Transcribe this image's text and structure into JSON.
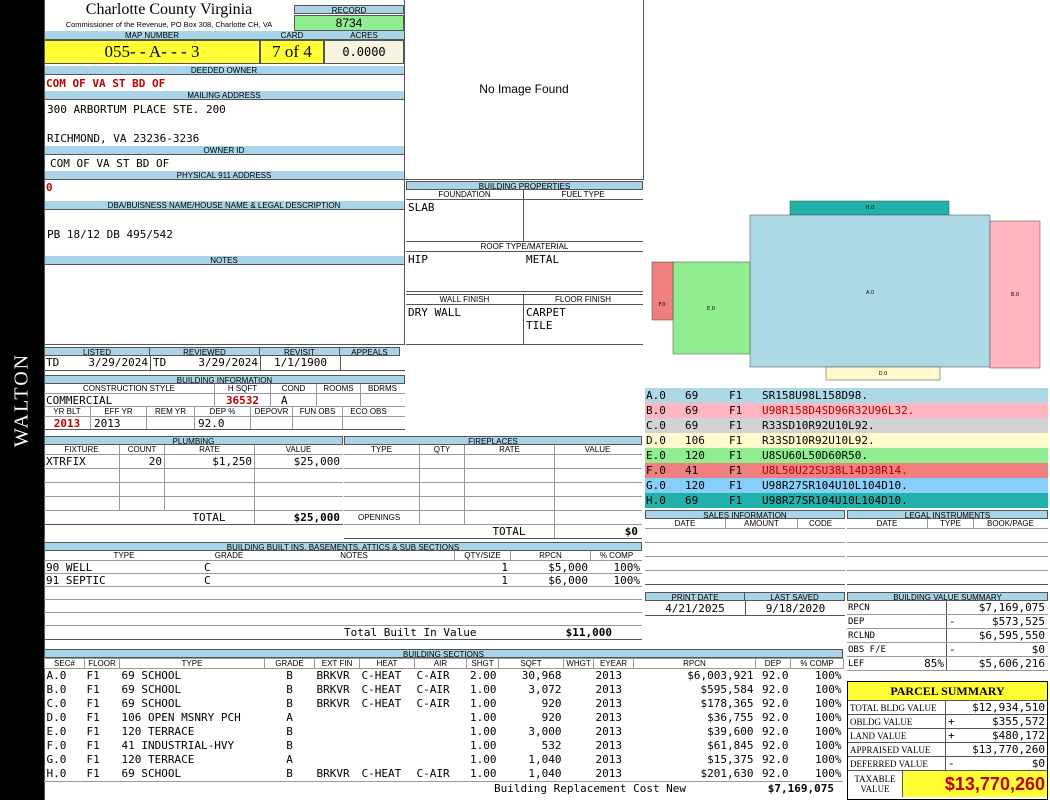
{
  "sidebar": {
    "name": "WALTON"
  },
  "header": {
    "county": "Charlotte County Virginia",
    "commissioner": "Commissioner of the Revenue, PO Box 308, Charlotte CH, VA",
    "record_label": "RECORD",
    "record_value": "8734",
    "map_number_label": "MAP NUMBER",
    "map_number": "055- - A- - - 3",
    "card_label": "CARD",
    "card": "7 of 4",
    "acres_label": "ACRES",
    "acres": "0.0000"
  },
  "owner": {
    "deeded_owner_label": "DEEDED OWNER",
    "deeded_owner": "COM OF VA ST BD OF",
    "mailing_address_label": "MAILING ADDRESS",
    "mailing_line1": "300 ARBORTUM PLACE STE. 200",
    "mailing_line2": "RICHMOND, VA 23236-3236",
    "owner_id_label": "OWNER ID",
    "owner_id": "COM OF VA ST BD OF",
    "physical_label": "PHYSICAL 911 ADDRESS",
    "physical": "0",
    "dba_label": "DBA/BUISNESS NAME/HOUSE NAME & LEGAL DESCRIPTION",
    "legal": "PB 18/12 DB 495/542",
    "notes_label": "NOTES"
  },
  "photo": {
    "text": "No Image Found"
  },
  "building_properties": {
    "title": "BUILDING PROPERTIES",
    "foundation_label": "FOUNDATION",
    "fuel_label": "FUEL TYPE",
    "foundation": "SLAB",
    "fuel": "",
    "roof_label": "ROOF TYPE/MATERIAL",
    "roof_type": "HIP",
    "roof_material": "METAL",
    "wall_label": "WALL FINISH",
    "floor_label": "FLOOR FINISH",
    "wall": "DRY WALL",
    "floor1": "CARPET",
    "floor2": "TILE"
  },
  "dates": {
    "listed_label": "LISTED",
    "reviewed_label": "REVIEWED",
    "revisit_label": "REVISIT",
    "appeals_label": "APPEALS",
    "listed_code": "TD",
    "listed": "3/29/2024",
    "reviewed_code": "TD",
    "reviewed": "3/29/2024",
    "revisit": "1/1/1900",
    "appeals": ""
  },
  "building_info": {
    "title": "BUILDING INFORMATION",
    "style_label": "CONSTRUCTION STYLE",
    "hsqft_label": "H SQFT",
    "cond_label": "COND",
    "rooms_label": "ROOMS",
    "bdrms_label": "BDRMS",
    "style": "COMMERCIAL",
    "hsqft": "36532",
    "cond": "A",
    "yrblt_label": "YR BLT",
    "effyr_label": "EFF YR",
    "remyr_label": "REM YR",
    "dep_label": "DEP %",
    "depovr_label": "DEPOVR",
    "funobs_label": "FUN OBS",
    "ecoobs_label": "ECO OBS",
    "yrblt": "2013",
    "effyr": "2013",
    "dep": "92.0"
  },
  "plumbing": {
    "title": "PLUMBING",
    "headers": [
      "FIXTURE",
      "COUNT",
      "RATE",
      "VALUE"
    ],
    "rows": [
      [
        "XTRFIX",
        "20",
        "$1,250",
        "$25,000"
      ]
    ],
    "total_label": "TOTAL",
    "total": "$25,000"
  },
  "fireplaces": {
    "title": "FIREPLACES",
    "headers": [
      "TYPE",
      "QTY",
      "RATE",
      "VALUE"
    ],
    "openings_label": "OPENINGS",
    "total_label": "TOTAL",
    "total": "$0"
  },
  "sketch": {
    "labels": [
      "A.0",
      "B.0",
      "C.0",
      "D.0",
      "E.0",
      "F.0",
      "G.0",
      "H.0"
    ],
    "colors": {
      "A": "#add8e6",
      "B": "#ffb6c1",
      "C": "#d3d3d3",
      "D": "#fffacd",
      "E": "#90ee90",
      "F": "#f08080",
      "G": "#87cefa",
      "H": "#20b2aa"
    }
  },
  "sections_legend": [
    {
      "id": "A.0",
      "n": "69",
      "f": "F1",
      "code": "SR158U98L158D98.",
      "color": "#add8e6"
    },
    {
      "id": "B.0",
      "n": "69",
      "f": "F1",
      "code": "U98R158D4SD96R32U96L32.",
      "color": "#ffb6c1"
    },
    {
      "id": "C.0",
      "n": "69",
      "f": "F1",
      "code": "R33SD10R92U10L92.",
      "color": "#d3d3d3"
    },
    {
      "id": "D.0",
      "n": "106",
      "f": "F1",
      "code": "R33SD10R92U10L92.",
      "color": "#fffacd"
    },
    {
      "id": "E.0",
      "n": "120",
      "f": "F1",
      "code": "U8SU60L50D60R50.",
      "color": "#90ee90"
    },
    {
      "id": "F.0",
      "n": "41",
      "f": "F1",
      "code": "U8L50U22SU38L14D38R14.",
      "color": "#f08080"
    },
    {
      "id": "G.0",
      "n": "120",
      "f": "F1",
      "code": "U98R27SR104U10L104D10.",
      "color": "#87cefa"
    },
    {
      "id": "H.0",
      "n": "69",
      "f": "F1",
      "code": "U98R27SR104U10L104D10.",
      "color": "#20b2aa"
    }
  ],
  "sales": {
    "title": "SALES INFORMATION",
    "headers": [
      "DATE",
      "AMOUNT",
      "CODE"
    ]
  },
  "legal_instruments": {
    "title": "LEGAL INSTRUMENTS",
    "headers": [
      "DATE",
      "TYPE",
      "BOOK/PAGE"
    ]
  },
  "print": {
    "print_label": "PRINT DATE",
    "saved_label": "LAST SAVED",
    "print_date": "4/21/2025",
    "last_saved": "9/18/2020"
  },
  "builtins": {
    "title": "BUILDING BUILT INS, BASEMENTS, ATTICS & SUB SECTIONS",
    "headers": [
      "TYPE",
      "GRADE",
      "NOTES",
      "QTY/SIZE",
      "RPCN",
      "% COMP"
    ],
    "rows": [
      [
        "90 WELL",
        "C",
        "",
        "1",
        "$5,000",
        "100%"
      ],
      [
        "91 SEPTIC",
        "C",
        "",
        "1",
        "$6,000",
        "100%"
      ]
    ],
    "total_label": "Total Built In Value",
    "total": "$11,000"
  },
  "value_summary": {
    "title": "BUILDING VALUE SUMMARY",
    "rows": [
      {
        "label": "RPCN",
        "pct": "",
        "sign": "",
        "value": "$7,169,075"
      },
      {
        "label": "DEP",
        "pct": "",
        "sign": "-",
        "value": "$573,525"
      },
      {
        "label": "RCLND",
        "pct": "",
        "sign": "",
        "value": "$6,595,550"
      },
      {
        "label": "OBS F/E",
        "pct": "",
        "sign": "-",
        "value": "$0"
      },
      {
        "label": "LEF",
        "pct": "85%",
        "sign": "",
        "value": "$5,606,216"
      }
    ]
  },
  "parcel_summary": {
    "title": "PARCEL SUMMARY",
    "rows": [
      {
        "label": "TOTAL BLDG VALUE",
        "sign": "",
        "value": "$12,934,510"
      },
      {
        "label": "OBLDG VALUE",
        "sign": "+",
        "value": "$355,572"
      },
      {
        "label": "LAND VALUE",
        "sign": "+",
        "value": "$480,172"
      },
      {
        "label": "APPRAISED VALUE",
        "sign": "",
        "value": "$13,770,260"
      },
      {
        "label": "DEFERRED VALUE",
        "sign": "-",
        "value": "$0"
      }
    ],
    "taxable_label": "TAXABLE VALUE",
    "taxable": "$13,770,260"
  },
  "sections": {
    "title": "BUILDING SECTIONS",
    "headers": [
      "SEC#",
      "FLOOR",
      "TYPE",
      "GRADE",
      "EXT FIN",
      "HEAT",
      "AIR",
      "SHGT",
      "SQFT",
      "WHGT",
      "EYEAR",
      "RPCN",
      "DEP",
      "% COMP"
    ],
    "rows": [
      [
        "A.0",
        "F1",
        "69 SCHOOL",
        "B",
        "BRKVR",
        "C-HEAT",
        "C-AIR",
        "2.00",
        "30,968",
        "",
        "2013",
        "$6,003,921",
        "92.0",
        "100%"
      ],
      [
        "B.0",
        "F1",
        "69 SCHOOL",
        "B",
        "BRKVR",
        "C-HEAT",
        "C-AIR",
        "1.00",
        "3,072",
        "",
        "2013",
        "$595,584",
        "92.0",
        "100%"
      ],
      [
        "C.0",
        "F1",
        "69 SCHOOL",
        "B",
        "BRKVR",
        "C-HEAT",
        "C-AIR",
        "1.00",
        "920",
        "",
        "2013",
        "$178,365",
        "92.0",
        "100%"
      ],
      [
        "D.0",
        "F1",
        "106 OPEN MSNRY PCH",
        "A",
        "",
        "",
        "",
        "1.00",
        "920",
        "",
        "2013",
        "$36,755",
        "92.0",
        "100%"
      ],
      [
        "E.0",
        "F1",
        "120 TERRACE",
        "B",
        "",
        "",
        "",
        "1.00",
        "3,000",
        "",
        "2013",
        "$39,600",
        "92.0",
        "100%"
      ],
      [
        "F.0",
        "F1",
        "41 INDUSTRIAL-HVY",
        "B",
        "",
        "",
        "",
        "1.00",
        "532",
        "",
        "2013",
        "$61,845",
        "92.0",
        "100%"
      ],
      [
        "G.0",
        "F1",
        "120 TERRACE",
        "A",
        "",
        "",
        "",
        "1.00",
        "1,040",
        "",
        "2013",
        "$15,375",
        "92.0",
        "100%"
      ],
      [
        "H.0",
        "F1",
        "69 SCHOOL",
        "B",
        "BRKVR",
        "C-HEAT",
        "C-AIR",
        "1.00",
        "1,040",
        "",
        "2013",
        "$201,630",
        "92.0",
        "100%"
      ]
    ],
    "replacement_label": "Building Replacement Cost New",
    "replacement": "$7,169,075"
  }
}
